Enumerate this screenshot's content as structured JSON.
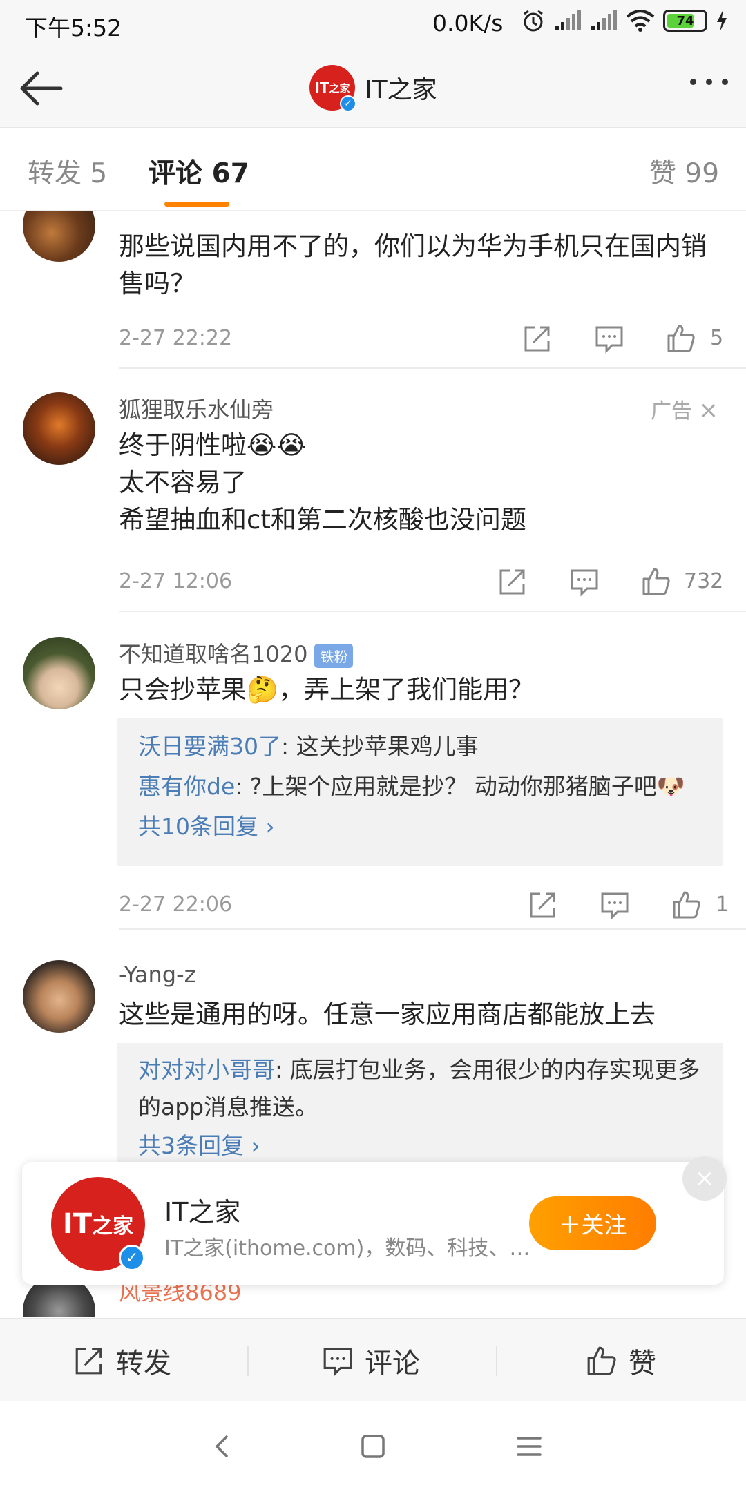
{
  "status_bar": {
    "time": "下午5:52",
    "net_speed": "0.0K/s",
    "battery": "74"
  },
  "nav": {
    "title": "IT之家",
    "logo_text": "IT之家"
  },
  "tabs": {
    "repost": "转发 5",
    "comments": "评论 67",
    "likes": "赞 99"
  },
  "comments": [
    {
      "username": "",
      "text": "那些说国内用不了的，你们以为华为手机只在国内销售吗？",
      "date": "2-27 22:22",
      "likes": "5"
    },
    {
      "username": "狐狸取乐水仙旁",
      "ad_label": "广告",
      "text_lines": [
        "终于阴性啦😭😭",
        "太不容易了",
        "希望抽血和ct和第二次核酸也没问题"
      ],
      "date": "2-27 12:06",
      "likes": "732"
    },
    {
      "username": "不知道取啥名1020",
      "badge": "铁粉",
      "text": "只会抄苹果🤔，弄上架了我们能用？",
      "replies": [
        {
          "who": "沃日要满30了",
          "text": ": 这关抄苹果鸡儿事"
        },
        {
          "who": "惠有你de",
          "text": ": ?上架个应用就是抄？ 动动你那猪脑子吧🐶"
        }
      ],
      "more_replies": "共10条回复 ›",
      "date": "2-27 22:06",
      "likes": "1"
    },
    {
      "username": "-Yang-z",
      "text": "这些是通用的呀。任意一家应用商店都能放上去",
      "replies": [
        {
          "who": "对对对小哥哥",
          "text": ": 底层打包业务，会用很少的内存实现更多的app消息推送。"
        }
      ],
      "more_replies": "共3条回复 ›"
    },
    {
      "username": "风景线8689"
    }
  ],
  "popup": {
    "name": "IT之家",
    "desc": "IT之家(ithome.com)，数码、科技、生活",
    "follow": "＋关注",
    "close": "×"
  },
  "bottom_bar": {
    "repost": "转发",
    "comment": "评论",
    "like": "赞"
  },
  "icons": [
    "back-arrow-icon",
    "more-icon",
    "share-icon",
    "comment-icon",
    "like-icon",
    "close-icon",
    "verified-icon",
    "alarm-icon",
    "signal-icon",
    "wifi-icon",
    "charging-icon"
  ],
  "colors": {
    "accent": "#ff8200",
    "link": "#4a7cb5",
    "brand_red": "#d7211c"
  }
}
